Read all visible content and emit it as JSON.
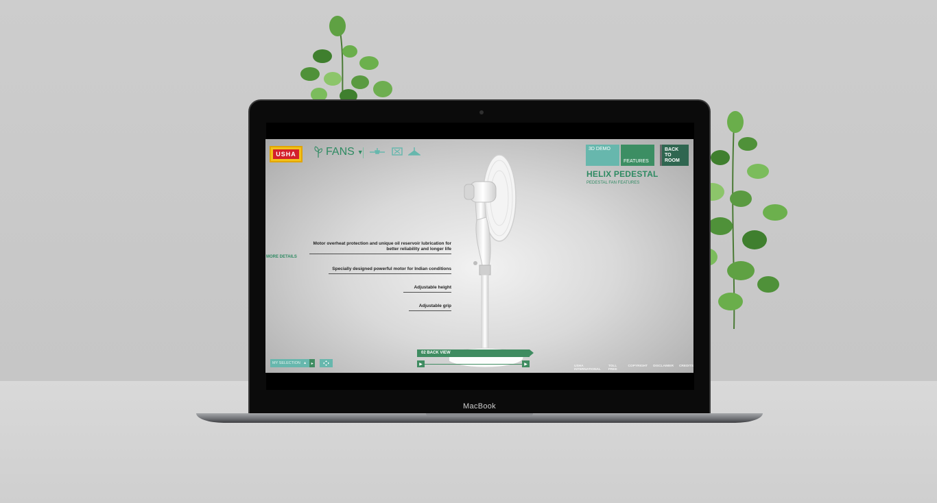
{
  "laptop": {
    "label": "MacBook"
  },
  "app": {
    "brand": "USHA",
    "category": "FANS",
    "tabs": {
      "demo": "3D DEMO",
      "features": "FEATURES",
      "back": "BACK TO ROOM"
    },
    "product": {
      "title": "HELIX PEDESTAL",
      "subtitle": "PEDESTAL FAN FEATURES"
    },
    "more_details": "MORE DETAILS",
    "features": [
      "Motor overheat protection and unique oil reservoir lubrication for better reliability and longer life",
      "Specially designed powerful motor for Indian conditions",
      "Adjustable height",
      "Adjustable grip"
    ],
    "view": {
      "label": "02 BACK VIEW"
    },
    "my_selection": "MY SELECTION",
    "footer_links": [
      "USHA INTERNATIONAL",
      "TOLL FREE",
      "COPYRIGHT",
      "DISCLAIMER",
      "CREDITS"
    ]
  },
  "colors": {
    "accent_green": "#2e8a62",
    "teal": "#67b7ad",
    "dark_green": "#2f6650"
  }
}
